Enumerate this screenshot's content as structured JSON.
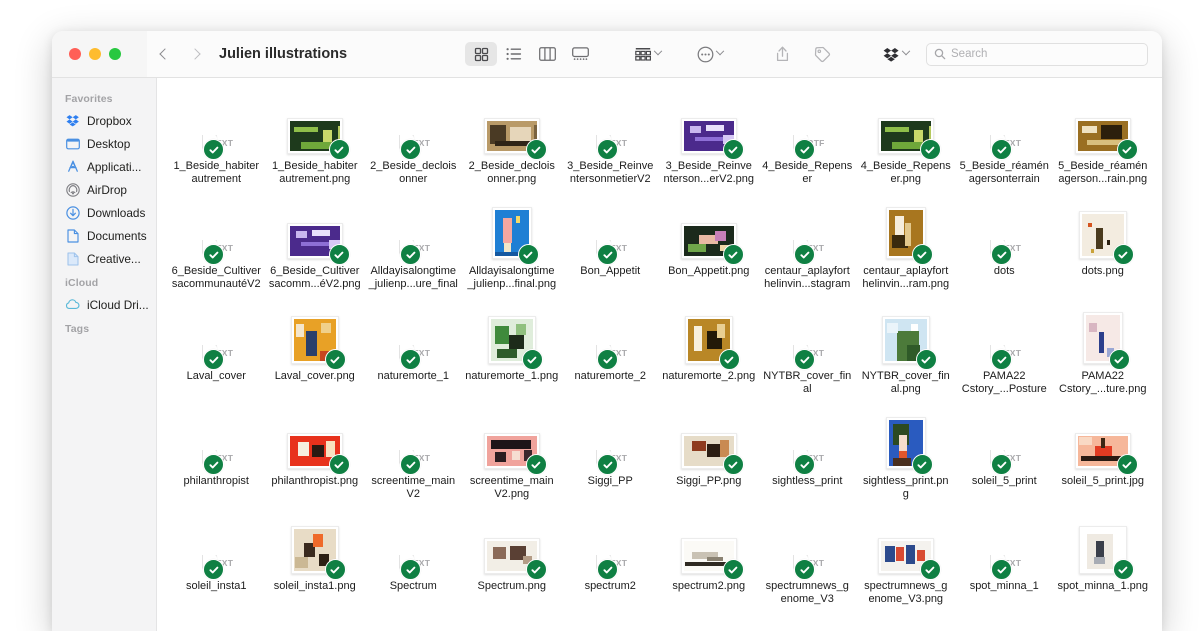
{
  "window": {
    "title": "Julien illustrations",
    "traffic_lights": [
      {
        "name": "close",
        "color": "#ff5f57"
      },
      {
        "name": "minimize",
        "color": "#febc2e"
      },
      {
        "name": "maximize",
        "color": "#28c840"
      }
    ]
  },
  "toolbar": {
    "back_label": "Back",
    "forward_label": "Forward",
    "views": [
      {
        "name": "icon-view",
        "label": "Icon View",
        "active": true
      },
      {
        "name": "list-view",
        "label": "List View",
        "active": false
      },
      {
        "name": "column-view",
        "label": "Column View",
        "active": false
      },
      {
        "name": "gallery-view",
        "label": "Gallery View",
        "active": false
      }
    ],
    "group_label": "Group items",
    "action_label": "Action",
    "share_label": "Share",
    "tag_label": "Edit Tags",
    "dropbox_label": "Dropbox"
  },
  "search": {
    "placeholder": "Search",
    "value": ""
  },
  "sidebar": {
    "sections": [
      {
        "title": "Favorites",
        "items": [
          {
            "label": "Dropbox",
            "icon": "dropbox-icon"
          },
          {
            "label": "Desktop",
            "icon": "desktop-icon"
          },
          {
            "label": "Applicati...",
            "icon": "applications-icon"
          },
          {
            "label": "AirDrop",
            "icon": "airdrop-icon"
          },
          {
            "label": "Downloads",
            "icon": "downloads-icon"
          },
          {
            "label": "Documents",
            "icon": "documents-icon"
          },
          {
            "label": "Creative...",
            "icon": "folder-file-icon"
          }
        ]
      },
      {
        "title": "iCloud",
        "items": [
          {
            "label": "iCloud Dri...",
            "icon": "icloud-icon"
          }
        ]
      },
      {
        "title": "Tags",
        "items": []
      }
    ]
  },
  "files": [
    {
      "name": "1_Beside_habiter autrement",
      "type": "doc",
      "ext": "TXT",
      "synced": true
    },
    {
      "name": "1_Beside_habiter autrement.png",
      "type": "image",
      "art": "circuit-green",
      "synced": true,
      "shape": "wide"
    },
    {
      "name": "2_Beside_declois onner",
      "type": "doc",
      "ext": "TXT",
      "synced": true
    },
    {
      "name": "2_Beside_declois onner.png",
      "type": "image",
      "art": "sepia-collage",
      "synced": true,
      "shape": "wide"
    },
    {
      "name": "3_Beside_Reinve ntersonmetierV2",
      "type": "doc",
      "ext": "TXT",
      "synced": true
    },
    {
      "name": "3_Beside_Reinve nterson...erV2.png",
      "type": "image",
      "art": "purple-poster",
      "synced": true,
      "shape": "wide"
    },
    {
      "name": "4_Beside_Repens er",
      "type": "doc",
      "ext": "RTF",
      "synced": true
    },
    {
      "name": "4_Beside_Repens er.png",
      "type": "image",
      "art": "circuit-green",
      "synced": true,
      "shape": "wide"
    },
    {
      "name": "5_Beside_réamén agersonterrain",
      "type": "doc",
      "ext": "TXT",
      "synced": true
    },
    {
      "name": "5_Beside_réamén agerson...rain.png",
      "type": "image",
      "art": "gold-poster",
      "synced": true,
      "shape": "wide"
    },
    {
      "name": "6_Beside_Cultiver sacommunautéV2",
      "type": "doc",
      "ext": "TXT",
      "synced": true
    },
    {
      "name": "6_Beside_Cultiver sacomm...éV2.png",
      "type": "image",
      "art": "purple-poster",
      "synced": true,
      "shape": "wide"
    },
    {
      "name": "Alldayisalongtime _julienp...ure_final",
      "type": "doc",
      "ext": "TXT",
      "synced": true
    },
    {
      "name": "Alldayisalongtime _julienp...final.png",
      "type": "image",
      "art": "blue-popsicle",
      "synced": true,
      "shape": "tall"
    },
    {
      "name": "Bon_Appetit",
      "type": "doc",
      "ext": "TXT",
      "synced": true
    },
    {
      "name": "Bon_Appetit.png",
      "type": "image",
      "art": "dark-foliage",
      "synced": true,
      "shape": "wide"
    },
    {
      "name": "centaur_aplayfort helinvin...stagram",
      "type": "doc",
      "ext": "TXT",
      "synced": true
    },
    {
      "name": "centaur_aplayfort helinvin...ram.png",
      "type": "image",
      "art": "gold-figure",
      "synced": true,
      "shape": "tall"
    },
    {
      "name": "dots",
      "type": "doc",
      "ext": "TXT",
      "synced": true
    },
    {
      "name": "dots.png",
      "type": "image",
      "art": "cream-walker",
      "synced": true,
      "shape": "square"
    },
    {
      "name": "Laval_cover",
      "type": "doc",
      "ext": "TXT",
      "synced": true
    },
    {
      "name": "Laval_cover.png",
      "type": "image",
      "art": "orange-grid",
      "synced": true,
      "shape": "square"
    },
    {
      "name": "naturemorte_1",
      "type": "doc",
      "ext": "TXT",
      "synced": true
    },
    {
      "name": "naturemorte_1.png",
      "type": "image",
      "art": "green-stilllife",
      "synced": true,
      "shape": "square"
    },
    {
      "name": "naturemorte_2",
      "type": "doc",
      "ext": "TXT",
      "synced": true
    },
    {
      "name": "naturemorte_2.png",
      "type": "image",
      "art": "ochre-abstract",
      "synced": true,
      "shape": "square"
    },
    {
      "name": "NYTBR_cover_fin al",
      "type": "doc",
      "ext": "TXT",
      "synced": true
    },
    {
      "name": "NYTBR_cover_fin al.png",
      "type": "image",
      "art": "map-coast",
      "synced": true,
      "shape": "square"
    },
    {
      "name": "PAMA22 Cstory_...Posture",
      "type": "doc",
      "ext": "TXT",
      "synced": true
    },
    {
      "name": "PAMA22 Cstory_...ture.png",
      "type": "image",
      "art": "pink-line-figure",
      "synced": true,
      "shape": "tall"
    },
    {
      "name": "philanthropist",
      "type": "doc",
      "ext": "TXT",
      "synced": true
    },
    {
      "name": "philanthropist.png",
      "type": "image",
      "art": "red-scene",
      "synced": true,
      "shape": "wide"
    },
    {
      "name": "screentime_main V2",
      "type": "doc",
      "ext": "TXT",
      "synced": true
    },
    {
      "name": "screentime_main V2.png",
      "type": "image",
      "art": "pink-cinema",
      "synced": true,
      "shape": "wide"
    },
    {
      "name": "Siggi_PP",
      "type": "doc",
      "ext": "TXT",
      "synced": true
    },
    {
      "name": "Siggi_PP.png",
      "type": "image",
      "art": "tan-abstract",
      "synced": true,
      "shape": "wide"
    },
    {
      "name": "sightless_print",
      "type": "doc",
      "ext": "TXT",
      "synced": true
    },
    {
      "name": "sightless_print.pn g",
      "type": "image",
      "art": "portrait-blue",
      "synced": true,
      "shape": "tall"
    },
    {
      "name": "soleil_5_print",
      "type": "doc",
      "ext": "TXT",
      "synced": true
    },
    {
      "name": "soleil_5_print.jpg",
      "type": "image",
      "art": "sunset-palm",
      "synced": true,
      "shape": "wide"
    },
    {
      "name": "soleil_insta1",
      "type": "doc",
      "ext": "TXT",
      "synced": true
    },
    {
      "name": "soleil_insta1.png",
      "type": "image",
      "art": "beige-orange-sun",
      "synced": true,
      "shape": "square"
    },
    {
      "name": "Spectrum",
      "type": "doc",
      "ext": "TXT",
      "synced": true
    },
    {
      "name": "Spectrum.png",
      "type": "image",
      "art": "noise-dots",
      "synced": true,
      "shape": "wide"
    },
    {
      "name": "spectrum2",
      "type": "doc",
      "ext": "TXT",
      "synced": true
    },
    {
      "name": "spectrum2.png",
      "type": "image",
      "art": "white-sketch",
      "synced": true,
      "shape": "wide"
    },
    {
      "name": "spectrumnews_g enome_V3",
      "type": "doc",
      "ext": "TXT",
      "synced": true
    },
    {
      "name": "spectrumnews_g enome_V3.png",
      "type": "image",
      "art": "blue-red-panels",
      "synced": true,
      "shape": "wide"
    },
    {
      "name": "spot_minna_1",
      "type": "doc",
      "ext": "TXT",
      "synced": true
    },
    {
      "name": "spot_minna_1.png",
      "type": "image",
      "art": "runner-circle",
      "synced": true,
      "shape": "square"
    }
  ],
  "colors": {
    "sync_badge_green": "#0f8043",
    "accent_blue": "#3a8ee6",
    "sidebar_bg": "#f4f4f5",
    "titlebar_bg": "#f6f6f6"
  }
}
